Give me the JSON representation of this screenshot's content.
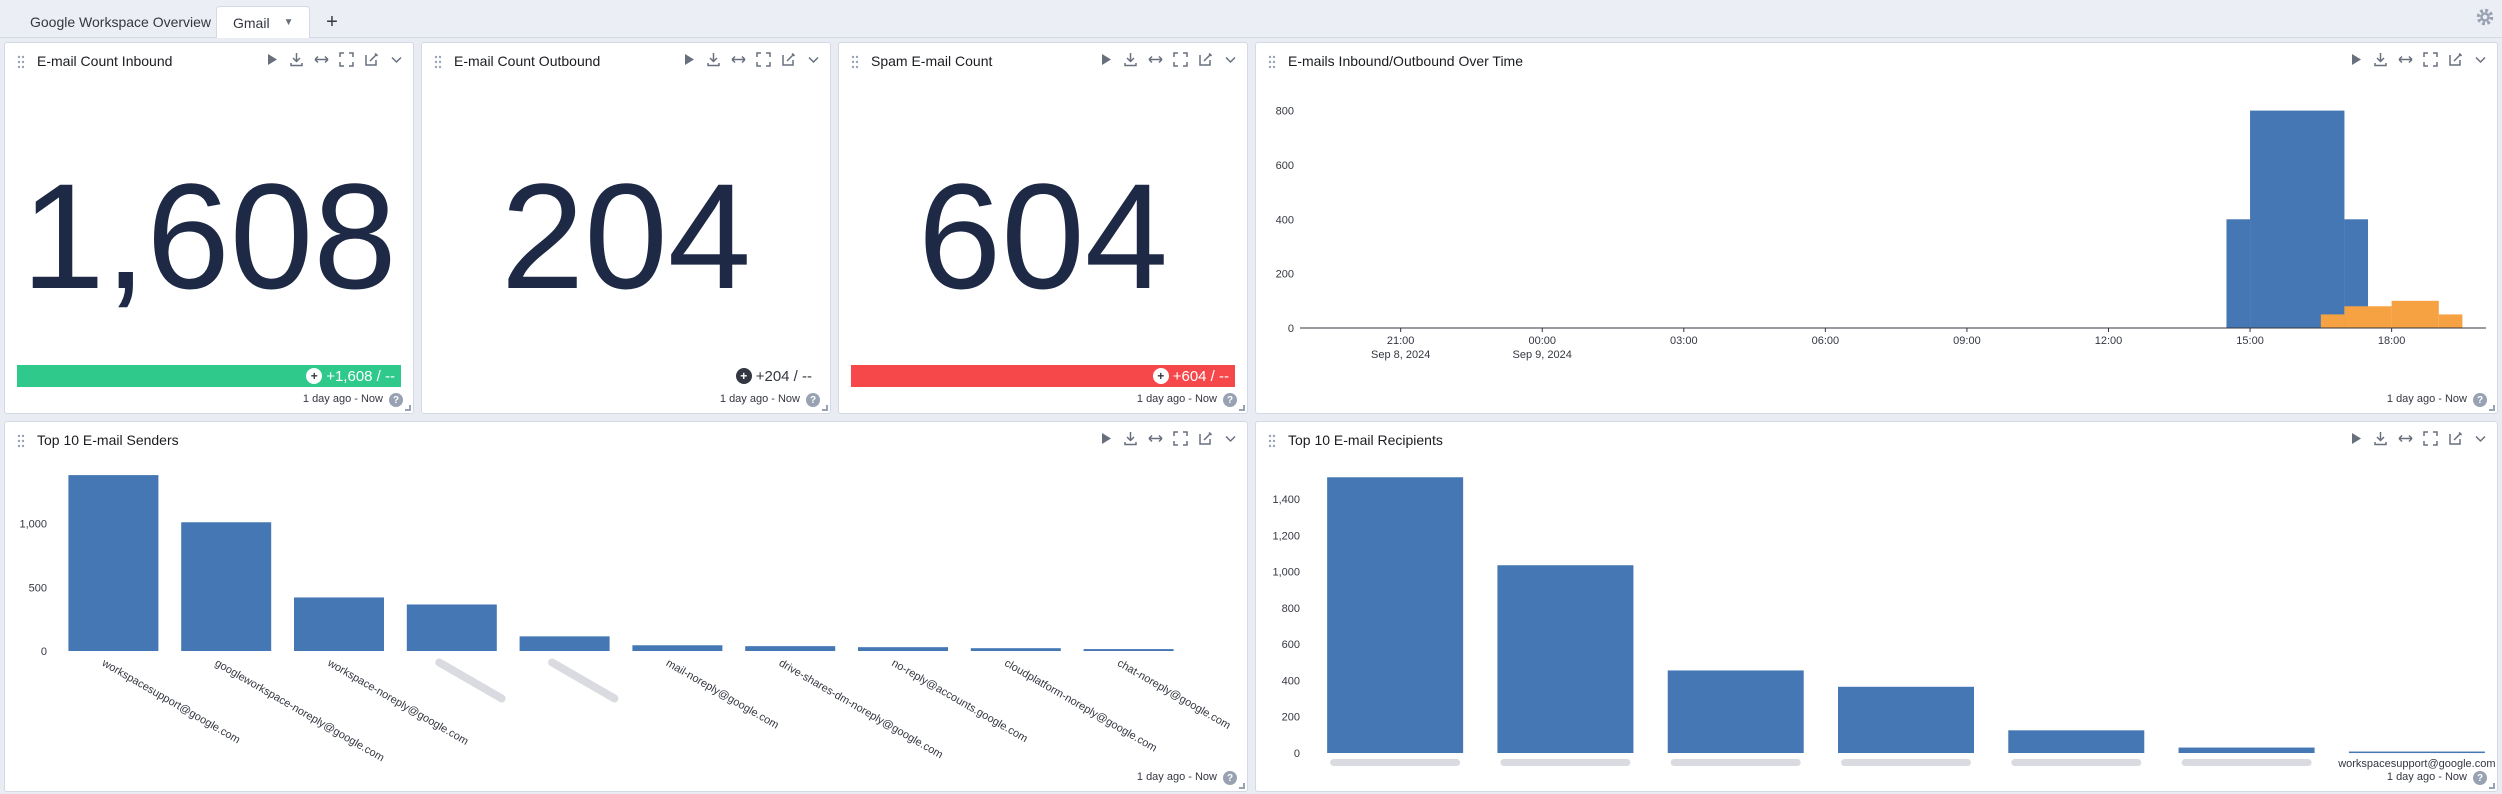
{
  "tabs": [
    {
      "label": "Google Workspace Overview",
      "active": false
    },
    {
      "label": "Gmail",
      "active": true
    }
  ],
  "add_tab_label": "+",
  "panels": {
    "inbound": {
      "title": "E-mail Count Inbound",
      "value": "1,608",
      "trend": "+1,608 / --",
      "trend_color": "#2ec98b",
      "timerange": "1 day ago - Now"
    },
    "outbound": {
      "title": "E-mail Count Outbound",
      "value": "204",
      "trend": "+204 / --",
      "timerange": "1 day ago - Now"
    },
    "spam": {
      "title": "Spam E-mail Count",
      "value": "604",
      "trend": "+604 / --",
      "trend_color": "#f6484a",
      "timerange": "1 day ago - Now"
    },
    "over_time": {
      "title": "E-mails Inbound/Outbound Over Time",
      "timerange": "1 day ago - Now"
    },
    "senders": {
      "title": "Top 10 E-mail Senders",
      "timerange": "1 day ago - Now"
    },
    "recipients": {
      "title": "Top 10 E-mail Recipients",
      "timerange": "1 day ago - Now"
    }
  },
  "help_label": "?",
  "chart_data": [
    {
      "type": "area",
      "panel": "over_time",
      "x_ticks": [
        {
          "label": "21:00",
          "sub": "Sep 8, 2024"
        },
        {
          "label": "00:00",
          "sub": "Sep 9, 2024"
        },
        {
          "label": "03:00",
          "sub": ""
        },
        {
          "label": "06:00",
          "sub": ""
        },
        {
          "label": "09:00",
          "sub": ""
        },
        {
          "label": "12:00",
          "sub": ""
        },
        {
          "label": "15:00",
          "sub": ""
        },
        {
          "label": "18:00",
          "sub": ""
        }
      ],
      "y_ticks": [
        0,
        200,
        400,
        600,
        800
      ],
      "ylim": [
        0,
        850
      ],
      "x_domain": [
        "Sep 8, 2024 18:52",
        "Sep 9, 2024 20:00"
      ],
      "series": [
        {
          "name": "inbound",
          "color": "#4477b4",
          "points": [
            {
              "start": "Sep 9, 2024 14:30",
              "end": "Sep 9, 2024 15:00",
              "value": 400
            },
            {
              "start": "Sep 9, 2024 15:00",
              "end": "Sep 9, 2024 17:00",
              "value": 800
            },
            {
              "start": "Sep 9, 2024 17:00",
              "end": "Sep 9, 2024 17:30",
              "value": 400
            }
          ]
        },
        {
          "name": "outbound",
          "color": "#f6a243",
          "points": [
            {
              "start": "Sep 9, 2024 16:30",
              "end": "Sep 9, 2024 17:00",
              "value": 50
            },
            {
              "start": "Sep 9, 2024 17:00",
              "end": "Sep 9, 2024 18:00",
              "value": 80
            },
            {
              "start": "Sep 9, 2024 18:00",
              "end": "Sep 9, 2024 19:00",
              "value": 100
            },
            {
              "start": "Sep 9, 2024 19:00",
              "end": "Sep 9, 2024 19:30",
              "value": 50
            }
          ]
        }
      ],
      "legend_placement": "bottom"
    },
    {
      "type": "bar",
      "panel": "senders",
      "categories": [
        "workspacesupport@google.com",
        "googleworkspace-noreply@google.com",
        "workspace-noreply@google.com",
        "",
        "",
        "mail-noreply@google.com",
        "drive-shares-dm-noreply@google.com",
        "no-reply@accounts.google.com",
        "cloudplatform-noreply@google.com",
        "chat-noreply@google.com"
      ],
      "values": [
        1380,
        1010,
        420,
        365,
        115,
        45,
        38,
        30,
        22,
        15
      ],
      "y_ticks": [
        0,
        500,
        1000
      ],
      "y_tick_labels": [
        "0",
        "500",
        "1,000"
      ],
      "ylim": [
        0,
        1420
      ],
      "color": "#4477b4"
    },
    {
      "type": "bar",
      "panel": "recipients",
      "categories": [
        "",
        "",
        "",
        "",
        "",
        "",
        "workspacesupport@google.com"
      ],
      "values": [
        1520,
        1035,
        455,
        365,
        125,
        30,
        8
      ],
      "y_ticks": [
        0,
        200,
        400,
        600,
        800,
        1000,
        1200,
        1400
      ],
      "y_tick_labels": [
        "0",
        "200",
        "400",
        "600",
        "800",
        "1,000",
        "1,200",
        "1,400"
      ],
      "ylim": [
        0,
        1560
      ],
      "color": "#4477b4"
    }
  ]
}
